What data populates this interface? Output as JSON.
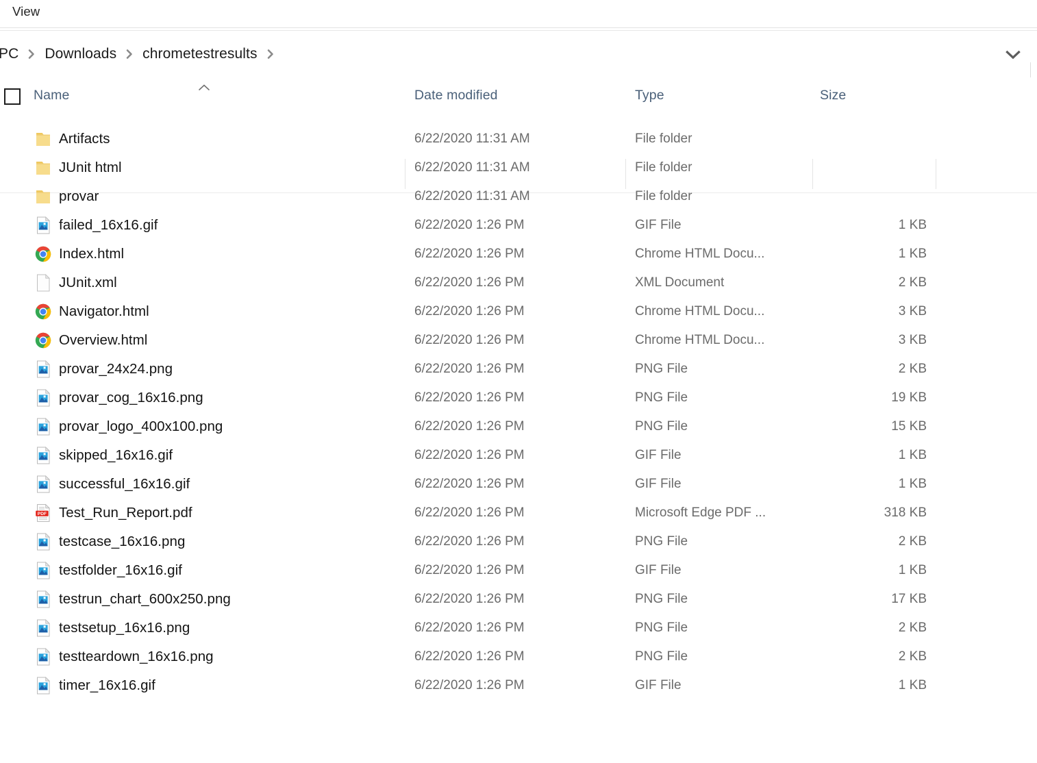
{
  "ribbon": {
    "tabs": [
      "View"
    ],
    "view_tab_label": "View"
  },
  "address_bar": {
    "breadcrumb": [
      {
        "label": "PC",
        "truncated": true
      },
      {
        "label": "Downloads",
        "truncated": false
      },
      {
        "label": "chrometestresults",
        "truncated": false
      }
    ],
    "dropdown_icon": "chevron-down-icon"
  },
  "columns": {
    "select_all_checkbox_checked": false,
    "name": "Name",
    "date_modified": "Date modified",
    "type": "Type",
    "size": "Size",
    "sort_column": "Name",
    "sort_direction": "ascending",
    "sort_icon": "caret-up-icon"
  },
  "colors": {
    "header_text": "#4a6079",
    "row_text": "#141414",
    "secondary_text": "#6b6b6b",
    "folder_yellow": "#f5d77e",
    "pdf_red": "#e2231a",
    "chrome_red": "#ea4335",
    "chrome_yellow": "#fbbc05",
    "chrome_green": "#34a853",
    "chrome_blue": "#4285f4",
    "image_thumb_blue": "#1f5fa8"
  },
  "files": [
    {
      "name": "Artifacts",
      "date": "6/22/2020 11:31 AM",
      "type": "File folder",
      "size": "",
      "icon": "folder-icon"
    },
    {
      "name": "JUnit html",
      "date": "6/22/2020 11:31 AM",
      "type": "File folder",
      "size": "",
      "icon": "folder-icon"
    },
    {
      "name": "provar",
      "date": "6/22/2020 11:31 AM",
      "type": "File folder",
      "size": "",
      "icon": "folder-icon"
    },
    {
      "name": "failed_16x16.gif",
      "date": "6/22/2020 1:26 PM",
      "type": "GIF File",
      "size": "1 KB",
      "icon": "image-file-icon"
    },
    {
      "name": "Index.html",
      "date": "6/22/2020 1:26 PM",
      "type": "Chrome HTML Docu...",
      "size": "1 KB",
      "icon": "chrome-icon"
    },
    {
      "name": "JUnit.xml",
      "date": "6/22/2020 1:26 PM",
      "type": "XML Document",
      "size": "2 KB",
      "icon": "blank-document-icon"
    },
    {
      "name": "Navigator.html",
      "date": "6/22/2020 1:26 PM",
      "type": "Chrome HTML Docu...",
      "size": "3 KB",
      "icon": "chrome-icon"
    },
    {
      "name": "Overview.html",
      "date": "6/22/2020 1:26 PM",
      "type": "Chrome HTML Docu...",
      "size": "3 KB",
      "icon": "chrome-icon"
    },
    {
      "name": "provar_24x24.png",
      "date": "6/22/2020 1:26 PM",
      "type": "PNG File",
      "size": "2 KB",
      "icon": "image-file-icon"
    },
    {
      "name": "provar_cog_16x16.png",
      "date": "6/22/2020 1:26 PM",
      "type": "PNG File",
      "size": "19 KB",
      "icon": "image-file-icon"
    },
    {
      "name": "provar_logo_400x100.png",
      "date": "6/22/2020 1:26 PM",
      "type": "PNG File",
      "size": "15 KB",
      "icon": "image-file-icon"
    },
    {
      "name": "skipped_16x16.gif",
      "date": "6/22/2020 1:26 PM",
      "type": "GIF File",
      "size": "1 KB",
      "icon": "image-file-icon"
    },
    {
      "name": "successful_16x16.gif",
      "date": "6/22/2020 1:26 PM",
      "type": "GIF File",
      "size": "1 KB",
      "icon": "image-file-icon"
    },
    {
      "name": "Test_Run_Report.pdf",
      "date": "6/22/2020 1:26 PM",
      "type": "Microsoft Edge PDF ...",
      "size": "318 KB",
      "icon": "pdf-file-icon"
    },
    {
      "name": "testcase_16x16.png",
      "date": "6/22/2020 1:26 PM",
      "type": "PNG File",
      "size": "2 KB",
      "icon": "image-file-icon"
    },
    {
      "name": "testfolder_16x16.gif",
      "date": "6/22/2020 1:26 PM",
      "type": "GIF File",
      "size": "1 KB",
      "icon": "image-file-icon"
    },
    {
      "name": "testrun_chart_600x250.png",
      "date": "6/22/2020 1:26 PM",
      "type": "PNG File",
      "size": "17 KB",
      "icon": "image-file-icon"
    },
    {
      "name": "testsetup_16x16.png",
      "date": "6/22/2020 1:26 PM",
      "type": "PNG File",
      "size": "2 KB",
      "icon": "image-file-icon"
    },
    {
      "name": "testteardown_16x16.png",
      "date": "6/22/2020 1:26 PM",
      "type": "PNG File",
      "size": "2 KB",
      "icon": "image-file-icon"
    },
    {
      "name": "timer_16x16.gif",
      "date": "6/22/2020 1:26 PM",
      "type": "GIF File",
      "size": "1 KB",
      "icon": "image-file-icon"
    }
  ]
}
